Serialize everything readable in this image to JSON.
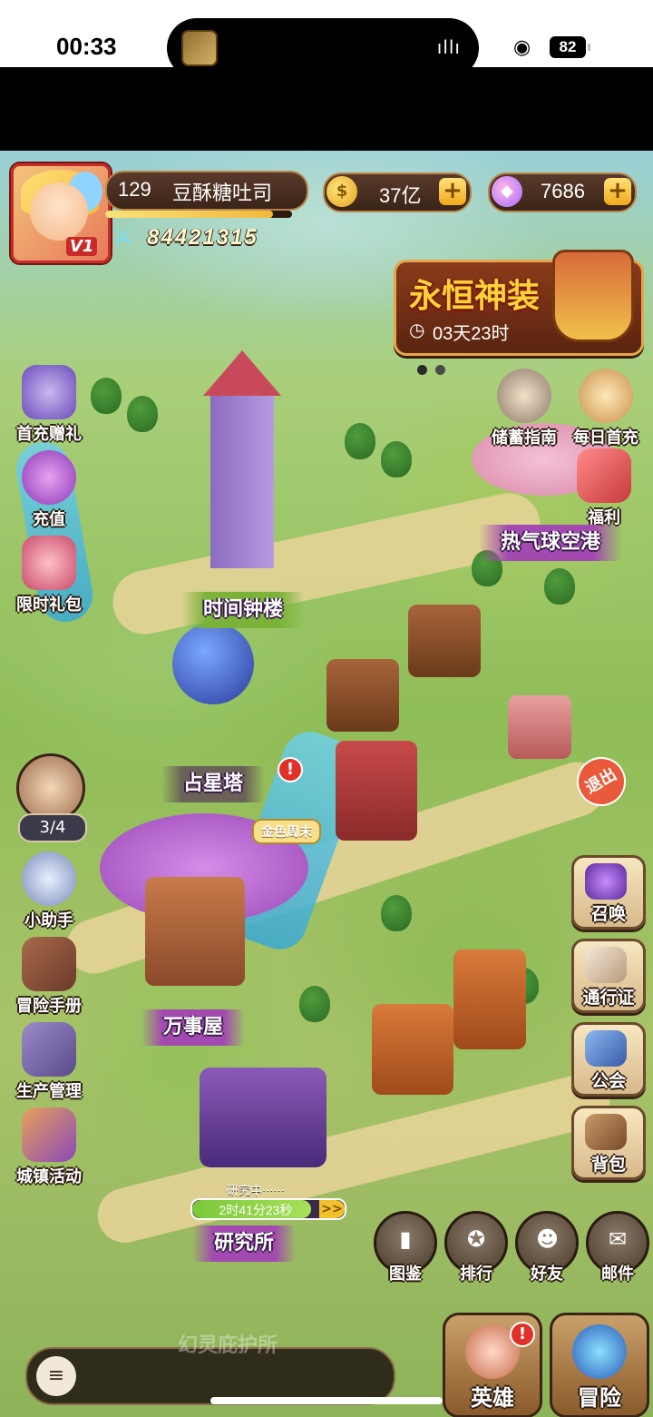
{
  "status_bar": {
    "time": "00:33",
    "wave_icon": "waveform-icon",
    "battery": "82"
  },
  "player": {
    "level": "129",
    "name": "豆酥糖吐司",
    "vip_label": "V1",
    "exp_fraction": 0.9,
    "power": "84421315"
  },
  "resources": {
    "gold": "37亿",
    "gems": "7686",
    "plus_label": "+"
  },
  "event_banner": {
    "title": "永恒神装",
    "timer": "03天23时"
  },
  "left_menu": {
    "first_recharge": "首充赠礼",
    "recharge": "充值",
    "limited_pack": "限时礼包",
    "quest_count": "3/4",
    "assistant": "小助手",
    "adventure_manual": "冒险手册",
    "production": "生产管理",
    "town_events": "城镇活动"
  },
  "right_menu": {
    "savings_guide": "储蓄指南",
    "daily_first_recharge": "每日首充",
    "welfare": "福利",
    "summon": "召唤",
    "pass": "通行证",
    "guild": "公会",
    "backpack": "背包"
  },
  "map_labels": {
    "clock_tower": "时间钟楼",
    "balloon_port": "热气球空港",
    "star_tower": "占星塔",
    "general_store": "万事屋",
    "research_institute": "研究所",
    "spirit_shelter": "幻灵庇护所",
    "golden_weekend": "金色周末",
    "exit": "退出"
  },
  "research": {
    "status": "研究中······",
    "time_left": "2时41分23秒",
    "progress": 0.78,
    "arrow": ">>"
  },
  "bottom_menu": {
    "codex": "图鉴",
    "ranking": "排行",
    "friends": "好友",
    "mail": "邮件",
    "heroes": "英雄",
    "adventure": "冒险"
  },
  "badge_text": "!",
  "colors": {
    "accent_gold": "#f2b93b",
    "ribbon_purple": "#a24ab0",
    "ribbon_green": "#7ab23a",
    "alert_red": "#e0302a"
  }
}
